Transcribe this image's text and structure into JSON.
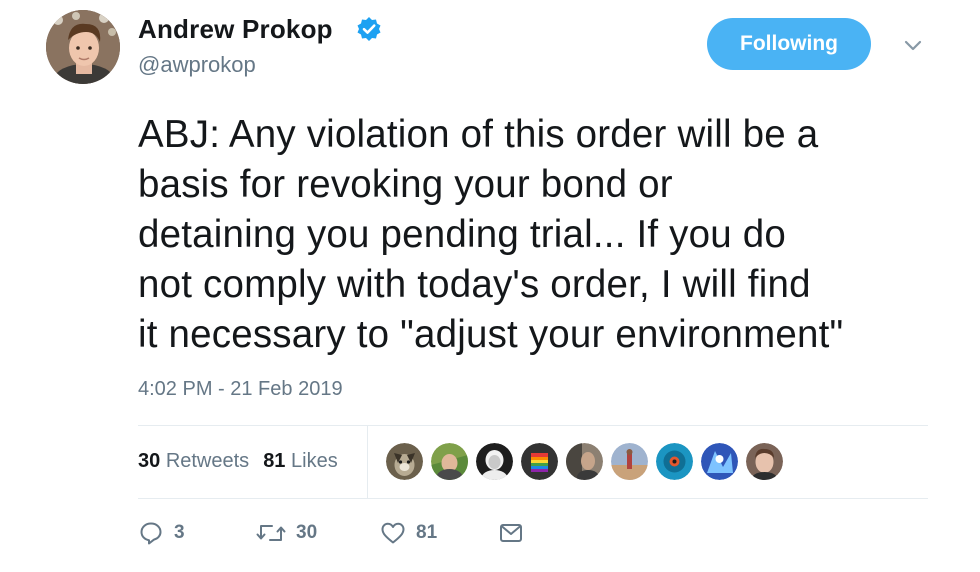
{
  "author": {
    "name": "Andrew Prokop",
    "handle": "@awprokop",
    "verified": true
  },
  "follow_button": {
    "label": "Following"
  },
  "tweet": {
    "lines": [
      "ABJ: Any violation of this order will be a",
      "basis for revoking your bond or",
      "detaining you pending trial... If you do",
      "not comply with today's order, I will find",
      "it necessary to \"adjust your environment\""
    ],
    "timestamp": "4:02 PM - 21 Feb 2019"
  },
  "stats": {
    "retweets_count": "30",
    "retweets_label": "Retweets",
    "likes_count": "81",
    "likes_label": "Likes"
  },
  "likers": [
    {
      "name": "liker-avatar-1",
      "color": "#5a4e3a"
    },
    {
      "name": "liker-avatar-2",
      "color": "#8aa04a"
    },
    {
      "name": "liker-avatar-3",
      "color": "#2b2b2b"
    },
    {
      "name": "liker-avatar-4",
      "color": "#3a3a3a"
    },
    {
      "name": "liker-avatar-5",
      "color": "#6e6458"
    },
    {
      "name": "liker-avatar-6",
      "color": "#7b8aa6"
    },
    {
      "name": "liker-avatar-7",
      "color": "#1f8fb5"
    },
    {
      "name": "liker-avatar-8",
      "color": "#3355aa"
    },
    {
      "name": "liker-avatar-9",
      "color": "#b08a78"
    }
  ],
  "actions": {
    "reply_count": "3",
    "retweet_count": "30",
    "like_count": "81"
  },
  "colors": {
    "accent": "#4ab3f4",
    "verified": "#1da1f2",
    "muted": "#657786",
    "text": "#14171a",
    "divider": "#e6ecf0"
  },
  "icons": {
    "verified": "verified-badge-icon",
    "more": "chevron-down-icon",
    "reply": "reply-icon",
    "retweet": "retweet-icon",
    "like": "heart-icon",
    "message": "envelope-icon"
  }
}
